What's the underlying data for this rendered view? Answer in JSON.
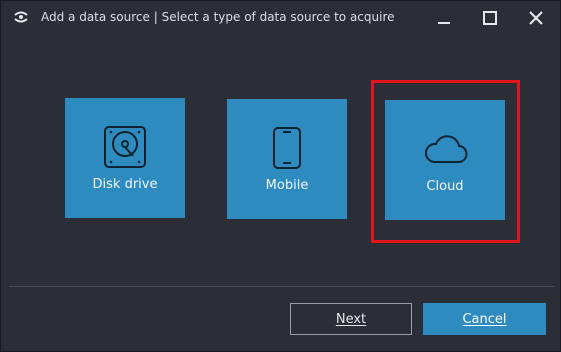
{
  "window": {
    "title": "Add a data source | Select a type of data source to acquire",
    "icon": "app-logo-icon",
    "controls": [
      "minimize-icon",
      "maximize-icon",
      "close-icon"
    ]
  },
  "sources": [
    {
      "label": "Disk drive",
      "icon": "hard-disk-icon"
    },
    {
      "label": "Mobile",
      "icon": "mobile-phone-icon"
    },
    {
      "label": "Cloud",
      "icon": "cloud-icon"
    }
  ],
  "highlighted_source": "Cloud",
  "buttons": {
    "next": "Next",
    "cancel": "Cancel"
  },
  "colors": {
    "background": "#2b2e37",
    "tile": "#2e8bbf",
    "highlight": "#e2141b"
  }
}
